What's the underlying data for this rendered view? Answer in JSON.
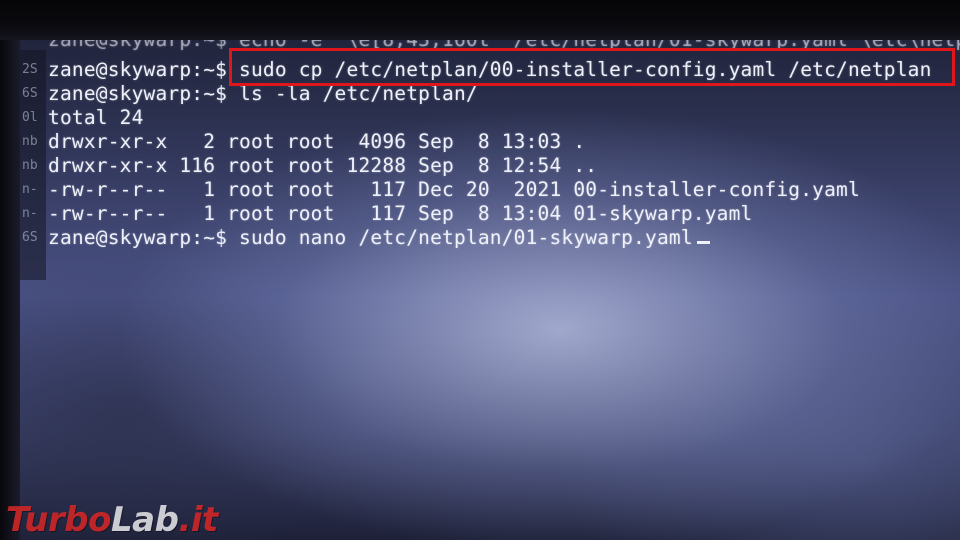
{
  "terminal": {
    "lines": [
      "zane@skywarp:~$ sudo cp /etc/netplan/00-installer-config.yaml /etc/netplan",
      "zane@skywarp:~$ ls -la /etc/netplan/",
      "total 24",
      "drwxr-xr-x   2 root root  4096 Sep  8 13:03 .",
      "drwxr-xr-x 116 root root 12288 Sep  8 12:54 ..",
      "-rw-r--r--   1 root root   117 Dec 20  2021 00-installer-config.yaml",
      "-rw-r--r--   1 root root   117 Sep  8 13:04 01-skywarp.yaml",
      "zane@skywarp:~$ sudo nano /etc/netplan/01-skywarp.yaml"
    ],
    "partial_top_line": "zane@skywarp:~$ echo -e '\\e[8;43;160t' /etc/netplan/01-skywarp.yaml \\etc\\netp",
    "highlighted_command": "sudo cp /etc/netplan/00-installer-config.yaml /etc/netplan",
    "highlight_color": "#e0161b",
    "gutter_marks": [
      "2S",
      "6S",
      "0l",
      "nb",
      "nb",
      "n-",
      "n-",
      "6S"
    ]
  },
  "watermark": {
    "brand_part1": "Turbo",
    "brand_part2": "Lab",
    "brand_part3": ".it",
    "color": "#dc2828"
  }
}
